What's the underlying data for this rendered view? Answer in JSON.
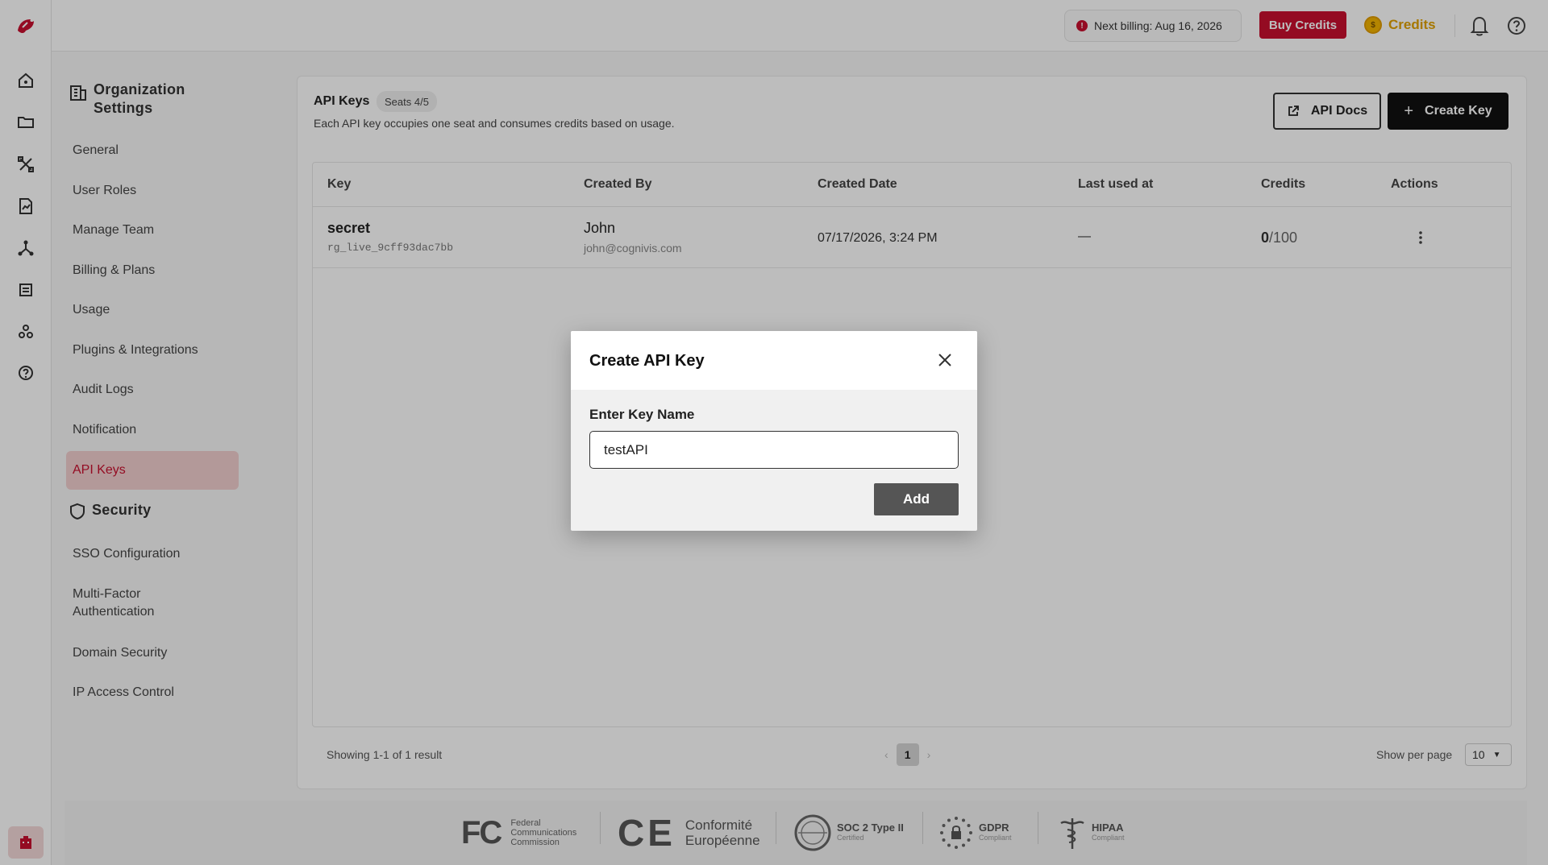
{
  "topbar": {
    "billing_text": "Next billing: Aug 16, 2026",
    "buy_credits_label": "Buy Credits",
    "credits_label": "Credits",
    "coin_symbol": "$"
  },
  "settings_nav": {
    "org_heading": "Organization Settings",
    "org_items": [
      {
        "label": "General"
      },
      {
        "label": "User Roles"
      },
      {
        "label": "Manage Team"
      },
      {
        "label": "Billing & Plans"
      },
      {
        "label": "Usage"
      },
      {
        "label": "Plugins & Integrations"
      },
      {
        "label": "Audit Logs"
      },
      {
        "label": "Notification"
      },
      {
        "label": "API Keys"
      }
    ],
    "security_heading": "Security",
    "security_items": [
      {
        "label": "SSO Configuration"
      },
      {
        "label": "Multi-Factor Authentication"
      },
      {
        "label": "Domain Security"
      },
      {
        "label": "IP Access Control"
      }
    ]
  },
  "main": {
    "title": "API Keys",
    "seats": "Seats 4/5",
    "subtitle": "Each API key occupies one seat and consumes credits based on usage.",
    "api_docs_label": "API Docs",
    "create_key_label": "Create Key"
  },
  "table": {
    "columns": [
      "Key",
      "Created By",
      "Created Date",
      "Last used at",
      "Credits",
      "Actions"
    ],
    "rows": [
      {
        "key_name": "secret",
        "key_code": "rg_live_9cff93dac7bb",
        "created_by_name": "John",
        "created_by_email": "john@cognivis.com",
        "created_date": "07/17/2026, 3:24 PM",
        "last_used": "—",
        "credits_used": "0",
        "credits_total": "/100"
      }
    ]
  },
  "pagination": {
    "showing_text": "Showing 1-1 of 1 result",
    "prev": "‹",
    "current_page": "1",
    "next": "›",
    "per_page_label": "Show per page",
    "per_page_value": "10"
  },
  "compliance": {
    "fcc_mark": "FC",
    "fcc_line1": "Federal",
    "fcc_line2": "Communications",
    "fcc_line3": "Commission",
    "ce_mark": "CE",
    "ce_line1": "Conformité",
    "ce_line2": "Européenne",
    "soc_title": "SOC 2 Type II",
    "soc_sub": "Certified",
    "gdpr_title": "GDPR",
    "gdpr_sub": "Compliant",
    "hipaa_title": "HIPAA",
    "hipaa_sub": "Compliant"
  },
  "modal": {
    "title": "Create API Key",
    "field_label": "Enter Key Name",
    "input_value": "testAPI",
    "add_label": "Add"
  },
  "colors": {
    "brand_red": "#c8102e",
    "active_nav_bg": "#f2cfcf",
    "credits_gold": "#e0a100",
    "dark_button": "#111111",
    "modal_add_button": "#555555"
  }
}
